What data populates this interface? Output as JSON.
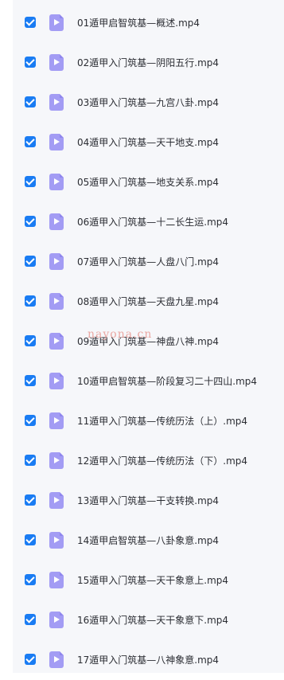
{
  "files": [
    {
      "name": "01遁甲启智筑基—概述.mp4",
      "checked": true,
      "icon": "video-file-icon"
    },
    {
      "name": "02遁甲入门筑基—阴阳五行.mp4",
      "checked": true,
      "icon": "video-file-icon"
    },
    {
      "name": "03遁甲入门筑基—九宫八卦.mp4",
      "checked": true,
      "icon": "video-file-icon"
    },
    {
      "name": "04遁甲入门筑基—天干地支.mp4",
      "checked": true,
      "icon": "video-file-icon"
    },
    {
      "name": "05遁甲入门筑基—地支关系.mp4",
      "checked": true,
      "icon": "video-file-icon"
    },
    {
      "name": "06遁甲入门筑基—十二长生运.mp4",
      "checked": true,
      "icon": "video-file-icon"
    },
    {
      "name": "07遁甲入门筑基—人盘八门.mp4",
      "checked": true,
      "icon": "video-file-icon"
    },
    {
      "name": "08遁甲入门筑基—天盘九星.mp4",
      "checked": true,
      "icon": "video-file-icon"
    },
    {
      "name": "09遁甲入门筑基—神盘八神.mp4",
      "checked": true,
      "icon": "video-file-icon"
    },
    {
      "name": "10遁甲启智筑基—阶段复习二十四山.mp4",
      "checked": true,
      "icon": "video-file-icon"
    },
    {
      "name": "11遁甲入门筑基—传统历法（上）.mp4",
      "checked": true,
      "icon": "video-file-icon"
    },
    {
      "name": "12遁甲入门筑基—传统历法（下）.mp4",
      "checked": true,
      "icon": "video-file-icon"
    },
    {
      "name": "13遁甲入门筑基—干支转换.mp4",
      "checked": true,
      "icon": "video-file-icon"
    },
    {
      "name": "14遁甲启智筑基—八卦象意.mp4",
      "checked": true,
      "icon": "video-file-icon"
    },
    {
      "name": "15遁甲入门筑基—天干象意上.mp4",
      "checked": true,
      "icon": "video-file-icon"
    },
    {
      "name": "16遁甲入门筑基—天干象意下.mp4",
      "checked": true,
      "icon": "video-file-icon"
    },
    {
      "name": "17遁甲入门筑基—八神象意.mp4",
      "checked": true,
      "icon": "video-file-icon"
    }
  ],
  "watermark": "nayona.cn",
  "colors": {
    "checkbox": "#1a7cf3",
    "file_icon": "#a39cf4",
    "text": "#2b2d33",
    "panel_background": "#f6f7fa",
    "watermark": "#e9a09a"
  }
}
